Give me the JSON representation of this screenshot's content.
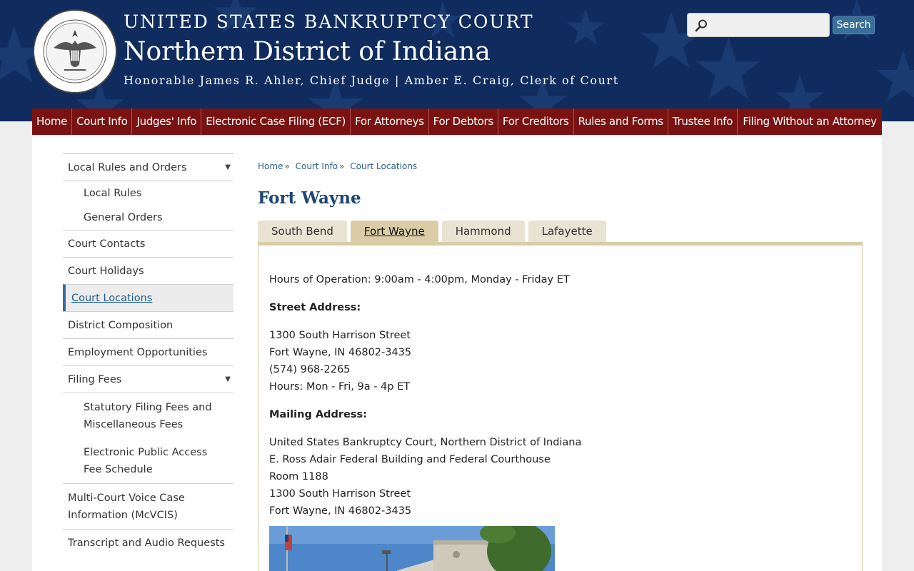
{
  "header": {
    "line1": "UNITED STATES BANKRUPTCY COURT",
    "line2": "Northern District of Indiana",
    "line3": "Honorable James R. Ahler, Chief Judge | Amber E. Craig, Clerk of Court",
    "search_placeholder": "",
    "search_button": "Search",
    "colors": {
      "header_bg": "#102c5e",
      "nav_bg": "#7b1212",
      "link": "#2a5f8e"
    }
  },
  "nav": [
    "Home",
    "Court Info",
    "Judges' Info",
    "Electronic Case Filing (ECF)",
    "For Attorneys",
    "For Debtors",
    "For Creditors",
    "Rules and Forms",
    "Trustee Info",
    "Filing Without an Attorney"
  ],
  "sidebar": {
    "local_rules": "Local Rules and Orders",
    "local_rules_sub1": "Local Rules",
    "local_rules_sub2": "General Orders",
    "court_contacts": "Court Contacts",
    "court_holidays": "Court Holidays",
    "court_locations": "Court Locations",
    "district_composition": "District Composition",
    "employment": "Employment Opportunities",
    "filing_fees": "Filing Fees",
    "filing_fees_sub1": "Statutory Filing Fees and Miscellaneous Fees",
    "filing_fees_sub2": "Electronic Public Access Fee Schedule",
    "mcvcis": "Multi-Court Voice Case Information (McVCIS)",
    "transcripts": "Transcript and Audio Requests"
  },
  "breadcrumb": {
    "home": "Home",
    "court_info": "Court Info",
    "current": "Court Locations",
    "separator": "»"
  },
  "page_title": "Fort Wayne",
  "tabs": [
    "South Bend",
    "Fort Wayne",
    "Hammond",
    "Lafayette"
  ],
  "location": {
    "hours": "Hours of Operation: 9:00am - 4:00pm, Monday - Friday ET",
    "street_heading": "Street Address:",
    "street_line1": "1300 South Harrison Street",
    "street_line2": "Fort Wayne, IN 46802-3435",
    "phone": "(574) 968-2265",
    "street_hours": "Hours: Mon - Fri, 9a - 4p ET",
    "mailing_heading": "Mailing Address:",
    "mail_line1": "United States Bankruptcy Court, Northern District of Indiana",
    "mail_line2": "E. Ross Adair Federal Building and Federal Courthouse",
    "mail_line3": "Room 1188",
    "mail_line4": "1300 South Harrison Street",
    "mail_line5": "Fort Wayne, IN 46802-3435"
  }
}
